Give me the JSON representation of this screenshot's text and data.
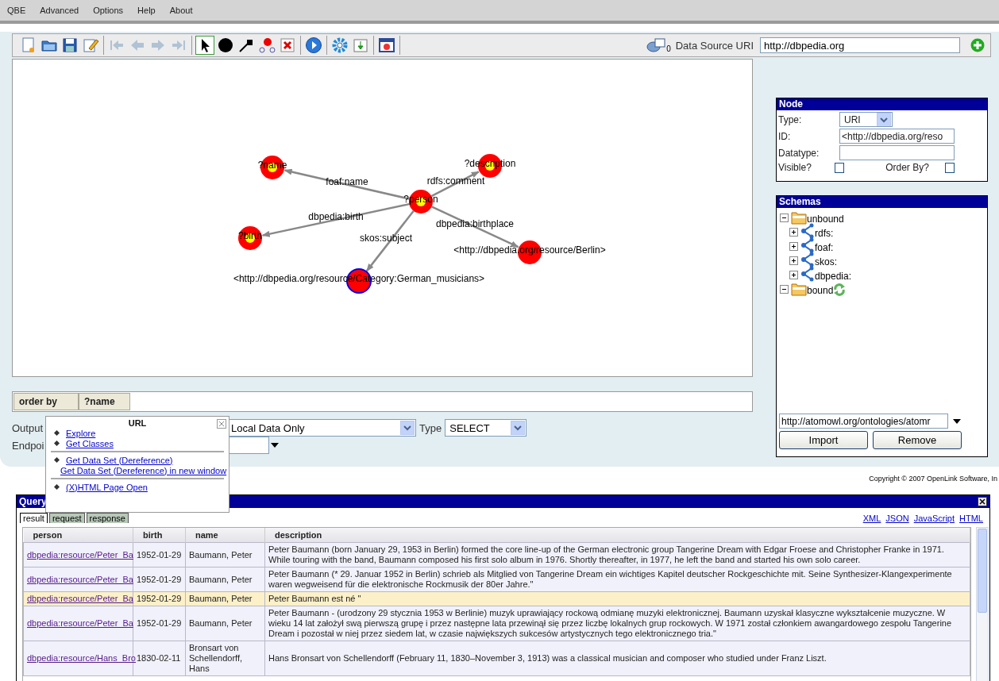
{
  "menu": [
    "QBE",
    "Advanced",
    "Options",
    "Help",
    "About"
  ],
  "toolbar": {
    "groups": [
      [
        {
          "kind": "new",
          "disabled": false,
          "selected": false
        },
        {
          "kind": "open",
          "disabled": false,
          "selected": false
        },
        {
          "kind": "save",
          "disabled": false,
          "selected": false
        },
        {
          "kind": "edit",
          "disabled": false,
          "selected": false
        }
      ],
      [
        {
          "kind": "first",
          "disabled": true,
          "selected": false
        },
        {
          "kind": "prev",
          "disabled": true,
          "selected": false
        },
        {
          "kind": "next",
          "disabled": true,
          "selected": false
        },
        {
          "kind": "last",
          "disabled": true,
          "selected": false
        }
      ],
      [
        {
          "kind": "pointer",
          "disabled": false,
          "selected": true
        },
        {
          "kind": "node",
          "disabled": false,
          "selected": false
        },
        {
          "kind": "edge",
          "disabled": false,
          "selected": false
        },
        {
          "kind": "connect",
          "disabled": false,
          "selected": false
        },
        {
          "kind": "delete",
          "disabled": false,
          "selected": false
        }
      ],
      [
        {
          "kind": "run",
          "disabled": false,
          "selected": false
        }
      ],
      [
        {
          "kind": "settings",
          "disabled": false,
          "selected": false
        },
        {
          "kind": "import",
          "disabled": false,
          "selected": false
        }
      ],
      [
        {
          "kind": "dialog",
          "disabled": false,
          "selected": false
        }
      ]
    ],
    "dataset_count": "0",
    "source_label": "Data Source URI",
    "source_value": "http://dbpedia.org"
  },
  "graph": {
    "nodes": [
      {
        "label": "?name",
        "kind": "variable",
        "selected": false
      },
      {
        "label": "?description",
        "kind": "variable",
        "selected": false
      },
      {
        "label": "?person",
        "kind": "variable",
        "selected": false
      },
      {
        "label": "?birth",
        "kind": "variable",
        "selected": false
      },
      {
        "label": "<http://dbpedia.org/resource/Berlin>",
        "kind": "resource",
        "selected": false
      },
      {
        "label": "<http://dbpedia.org/resource/Category:German_musicians>",
        "kind": "resource",
        "selected": true
      }
    ],
    "edges": [
      {
        "label": "foaf:name"
      },
      {
        "label": "rdfs:comment"
      },
      {
        "label": "dbpedia:birth"
      },
      {
        "label": "skos:subject"
      },
      {
        "label": "dbpedia:birthplace"
      }
    ]
  },
  "order_by": {
    "label": "order by",
    "items": [
      "?name"
    ]
  },
  "output": {
    "label": "Output",
    "value": "Local Data Only",
    "type_label": "Type",
    "type_value": "SELECT",
    "endpoint_label": "Endpoi"
  },
  "node_panel": {
    "title": "Node",
    "type_label": "Type:",
    "type_value": "URI",
    "id_label": "ID:",
    "id_value": "<http://dbpedia.org/reso",
    "datatype_label": "Datatype:",
    "visible_label": "Visible?",
    "visible": false,
    "order_label": "Order By?",
    "order_by": false
  },
  "schemas": {
    "title": "Schemas",
    "tree": [
      {
        "label": "unbound",
        "kind": "folder",
        "expanded": true,
        "children": [
          {
            "label": "rdfs:",
            "kind": "schema",
            "expanded": false
          },
          {
            "label": "foaf:",
            "kind": "schema",
            "expanded": false
          },
          {
            "label": "skos:",
            "kind": "schema",
            "expanded": false
          },
          {
            "label": "dbpedia:",
            "kind": "schema",
            "expanded": false
          }
        ]
      },
      {
        "label": "bound",
        "kind": "folder",
        "expanded": true,
        "refresh": true
      }
    ],
    "url_value": "http://atomowl.org/ontologies/atomr",
    "buttons": [
      "Import",
      "Remove"
    ]
  },
  "copyright": "Copyright © 2007 OpenLink Software, In",
  "popup": {
    "title": "URL",
    "groups": [
      [
        "Explore",
        "Get Classes"
      ],
      [
        "Get Data Set (Dereference)",
        "Get Data Set (Dereference) in new window"
      ],
      [
        "(X)HTML Page Open"
      ]
    ]
  },
  "query": {
    "title": "Query",
    "tabs": [
      {
        "label": "result",
        "selected": true
      },
      {
        "label": "request",
        "selected": false
      },
      {
        "label": "response",
        "selected": false
      }
    ],
    "formats": [
      "XML",
      "JSON",
      "JavaScript",
      "HTML"
    ],
    "columns": [
      "person",
      "birth",
      "name",
      "description"
    ],
    "rows": [
      {
        "selected": false,
        "cells": [
          "dbpedia:resource/Peter_Ba",
          "1952-01-29",
          "Baumann, Peter",
          "Peter Baumann (born January 29, 1953 in Berlin) formed the core line-up of the German electronic group Tangerine Dream with Edgar Froese and Christopher Franke in 1971. While touring with the band, Baumann composed his first solo album in 1976. Shortly thereafter, in 1977, he left the band and started his own solo career."
        ]
      },
      {
        "selected": false,
        "cells": [
          "dbpedia:resource/Peter_Ba",
          "1952-01-29",
          "Baumann, Peter",
          "Peter Baumann (* 29. Januar 1952 in Berlin) schrieb als Mitglied von Tangerine Dream ein wichtiges Kapitel deutscher Rockgeschichte mit. Seine Synthesizer-Klangexperimente waren wegweisend für die elektronische Rockmusik der 80er Jahre.\""
        ]
      },
      {
        "selected": true,
        "cells": [
          "dbpedia:resource/Peter_Ba",
          "1952-01-29",
          "Baumann, Peter",
          "Peter Baumann est né \""
        ]
      },
      {
        "selected": false,
        "cells": [
          "dbpedia:resource/Peter_Ba",
          "1952-01-29",
          "Baumann, Peter",
          "Peter Baumann - (urodzony 29 stycznia 1953 w Berlinie) muzyk uprawiający rockową odmianę muzyki elektronicznej. Baumann uzyskał klasyczne wykształcenie muzyczne. W wieku 14 lat założył swą pierwszą grupę i przez następne lata przewinął się przez liczbę lokalnych grup rockowych. W 1971 został członkiem awangardowego zespołu Tangerine Dream i pozostał w niej przez siedem lat, w czasie największych sukcesów artystycznych tego elektronicznego tria.\""
        ]
      },
      {
        "selected": false,
        "cells": [
          "dbpedia:resource/Hans_Bro",
          "1830-02-11",
          "Bronsart von Schellendorff, Hans",
          "Hans Bronsart von Schellendorff (February 11, 1830–November 3, 1913) was a classical musician and composer who studied under Franz Liszt."
        ]
      }
    ]
  }
}
